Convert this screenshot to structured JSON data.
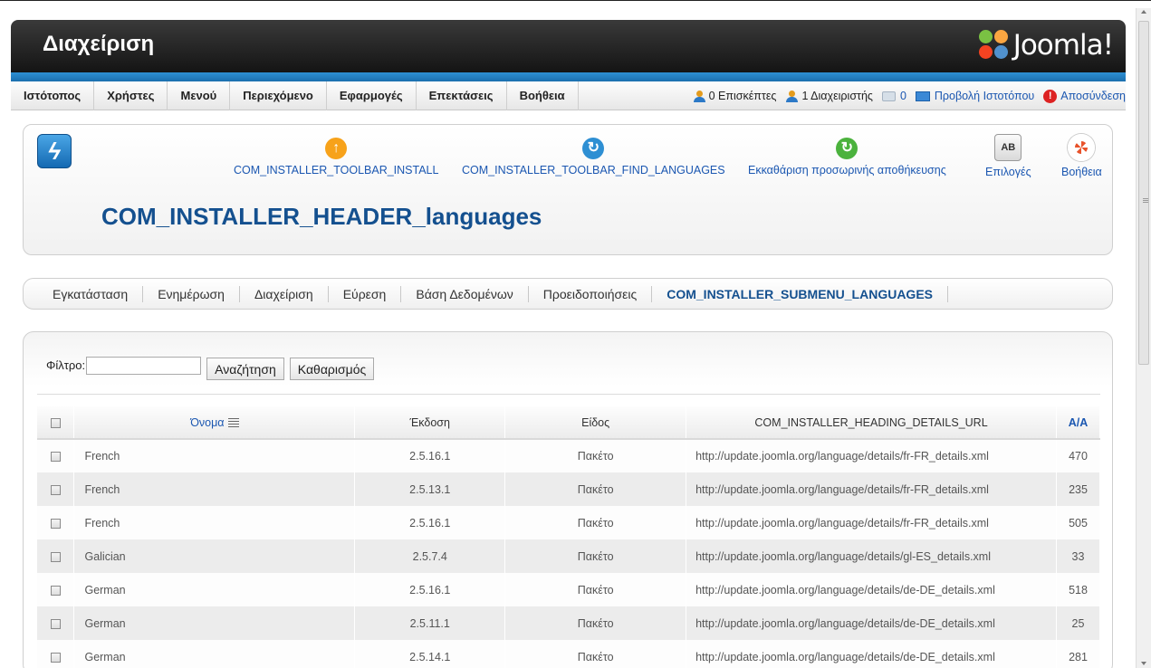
{
  "header": {
    "title": "Διαχείριση",
    "logo_text": "Joomla!"
  },
  "menu": {
    "items": [
      "Ιστότοπος",
      "Χρήστες",
      "Μενού",
      "Περιεχόμενο",
      "Εφαρμογές",
      "Επεκτάσεις",
      "Βοήθεια"
    ],
    "status": {
      "visitors": "0 Επισκέπτες",
      "admins": "1 Διαχειριστής",
      "messages": "0",
      "view_site": "Προβολή Ιστοτόπου",
      "logout": "Αποσύνδεση"
    }
  },
  "toolbar": {
    "install": "COM_INSTALLER_TOOLBAR_INSTALL",
    "find_languages": "COM_INSTALLER_TOOLBAR_FIND_LANGUAGES",
    "purge_cache": "Εκκαθάριση προσωρινής αποθήκευσης",
    "options": "Επιλογές",
    "help": "Βοήθεια",
    "options_icon_text": "AB"
  },
  "page_title": "COM_INSTALLER_HEADER_languages",
  "submenu": {
    "items": [
      "Εγκατάσταση",
      "Ενημέρωση",
      "Διαχείριση",
      "Εύρεση",
      "Βάση Δεδομένων",
      "Προειδοποιήσεις",
      "COM_INSTALLER_SUBMENU_LANGUAGES"
    ],
    "active_index": 6
  },
  "filter": {
    "label": "Φίλτρο:",
    "value": "",
    "search_button": "Αναζήτηση",
    "clear_button": "Καθαρισμός"
  },
  "table": {
    "headers": {
      "name": "Όνομα",
      "version": "Έκδοση",
      "type": "Είδος",
      "url": "COM_INSTALLER_HEADING_DETAILS_URL",
      "id": "Α/Α"
    },
    "rows": [
      {
        "name": "French",
        "version": "2.5.16.1",
        "type": "Πακέτο",
        "url": "http://update.joomla.org/language/details/fr-FR_details.xml",
        "id": "470"
      },
      {
        "name": "French",
        "version": "2.5.13.1",
        "type": "Πακέτο",
        "url": "http://update.joomla.org/language/details/fr-FR_details.xml",
        "id": "235"
      },
      {
        "name": "French",
        "version": "2.5.16.1",
        "type": "Πακέτο",
        "url": "http://update.joomla.org/language/details/fr-FR_details.xml",
        "id": "505"
      },
      {
        "name": "Galician",
        "version": "2.5.7.4",
        "type": "Πακέτο",
        "url": "http://update.joomla.org/language/details/gl-ES_details.xml",
        "id": "33"
      },
      {
        "name": "German",
        "version": "2.5.16.1",
        "type": "Πακέτο",
        "url": "http://update.joomla.org/language/details/de-DE_details.xml",
        "id": "518"
      },
      {
        "name": "German",
        "version": "2.5.11.1",
        "type": "Πακέτο",
        "url": "http://update.joomla.org/language/details/de-DE_details.xml",
        "id": "25"
      },
      {
        "name": "German",
        "version": "2.5.14.1",
        "type": "Πακέτο",
        "url": "http://update.joomla.org/language/details/de-DE_details.xml",
        "id": "281"
      }
    ]
  },
  "colors": {
    "accent_blue": "#1b57b1",
    "title_blue": "#14508f",
    "header_dark": "#141414",
    "brand_bar": "#2e8fd3"
  }
}
